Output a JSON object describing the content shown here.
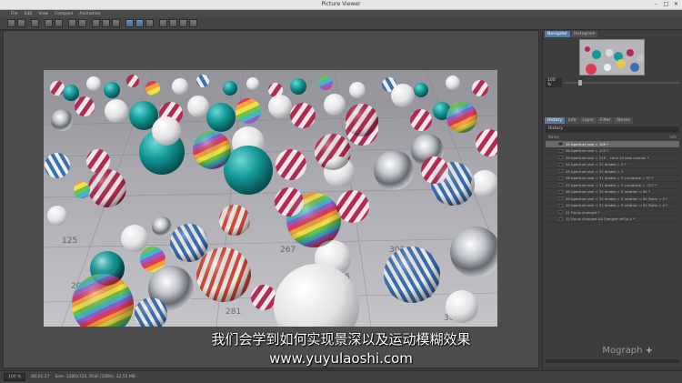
{
  "window": {
    "title": "Picture Viewer"
  },
  "menu": [
    "File",
    "Edit",
    "View",
    "Compare",
    "Animation"
  ],
  "navigator_tabs": [
    "Navigator",
    "Histogram"
  ],
  "navigator_zoom": "100 %",
  "history_tabs": [
    "History",
    "Info",
    "Layer",
    "Filter",
    "Stereo"
  ],
  "history_header": "History",
  "history_columns": {
    "name": "Name",
    "info": "Info"
  },
  "history_items": [
    "10 Aperture size = 105 *",
    "08 Aperture size = 223 *",
    "09 Aperture size = 215 .. cone 10 lens caution *",
    "04 Aperture size = 31 blades = 3 *",
    "05 Aperture size = 31 blades = 3",
    "06 Aperture size = 31 blades = 3 curvature = 57 *",
    "07 Aperture size = 31 blades = 3 curvature = -127 *",
    "08 Aperture size = 31 blades = 3 rotation = 61 *",
    "09 Aperture size = 31 blades = 3 rotation = 61 Ratio = 2 *",
    "10 Aperture size = 31 blades = 3 rotation = 61 Ratio = 4 *",
    "11 Focus changed *",
    "12 Focus changed AA Sampler off to 4 *"
  ],
  "status": {
    "zoom": "100 %",
    "time": "00:01:27",
    "size": "Size: 1280x720, RGB (32Bit), 32.55 MB"
  },
  "watermark": "Mograph",
  "subtitle_cn": "我们会学到如何实现景深以及运动模糊效果",
  "subtitle_url": "www.yuyulaoshi.com"
}
